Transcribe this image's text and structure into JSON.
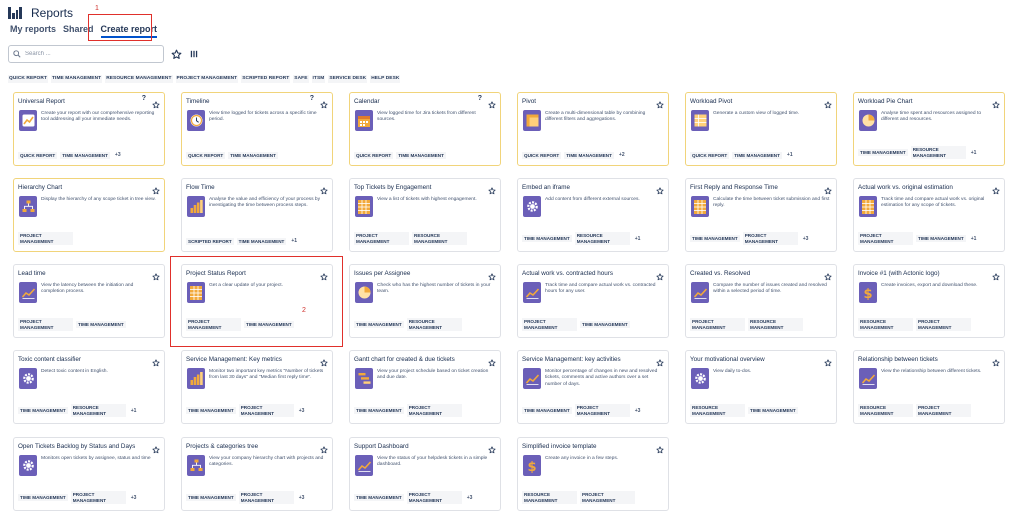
{
  "header": {
    "title": "Reports"
  },
  "annotations": {
    "one": "1",
    "two": "2"
  },
  "tabs": [
    {
      "label": "My reports"
    },
    {
      "label": "Shared"
    },
    {
      "label": "Create report"
    }
  ],
  "search": {
    "placeholder": "Search ..."
  },
  "filters": [
    "QUICK REPORT",
    "TIME MANAGEMENT",
    "RESOURCE MANAGEMENT",
    "PROJECT MANAGEMENT",
    "SCRIPTED REPORT",
    "SAFE",
    "ITSM",
    "SERVICE DESK",
    "HELP DESK"
  ],
  "cards": [
    {
      "title": "Universal Report",
      "help": "?",
      "desc": "Create your report with our comprehensive reporting tool addressing all your immediate needs.",
      "tags": [
        "QUICK REPORT",
        "TIME MANAGEMENT"
      ],
      "more": "+3",
      "icon": "universal-report-icon",
      "highlight": true
    },
    {
      "title": "Timeline",
      "help": "?",
      "desc": "View time logged for tickets across a specific time period.",
      "tags": [
        "QUICK REPORT",
        "TIME MANAGEMENT"
      ],
      "more": "",
      "icon": "clock-icon",
      "highlight": true
    },
    {
      "title": "Calendar",
      "help": "?",
      "desc": "View logged time for Jira tickets from different sources.",
      "tags": [
        "QUICK REPORT",
        "TIME MANAGEMENT"
      ],
      "more": "",
      "icon": "calendar-icon",
      "highlight": true
    },
    {
      "title": "Pivot",
      "help": "",
      "desc": "Create a multi-dimensional table by combining different filters and aggregations.",
      "tags": [
        "QUICK REPORT",
        "TIME MANAGEMENT"
      ],
      "more": "+2",
      "icon": "pivot-icon",
      "highlight": true
    },
    {
      "title": "Workload Pivot",
      "help": "",
      "desc": "Generate a custom view of logged time.",
      "tags": [
        "QUICK REPORT",
        "TIME MANAGEMENT"
      ],
      "more": "+1",
      "icon": "workload-pivot-icon",
      "highlight": true
    },
    {
      "title": "Workload Pie Chart",
      "help": "",
      "desc": "Analyse time spent and resources assigned to different and resources.",
      "tags": [
        "TIME MANAGEMENT",
        "RESOURCE MANAGEMENT"
      ],
      "more": "+1",
      "icon": "pie-chart-icon",
      "highlight": true
    },
    {
      "title": "Hierarchy Chart",
      "help": "",
      "desc": "Display the hierarchy of any scope ticket in tree view.",
      "tags": [
        "PROJECT MANAGEMENT"
      ],
      "more": "",
      "icon": "hierarchy-icon",
      "highlight": true
    },
    {
      "title": "Flow Time",
      "help": "",
      "desc": "Analyse the value and efficiency of your process by investigating the time between process steps.",
      "tags": [
        "SCRIPTED REPORT",
        "TIME MANAGEMENT"
      ],
      "more": "+1",
      "icon": "bar-chart-icon",
      "highlight": false
    },
    {
      "title": "Top Tickets by Engagement",
      "help": "",
      "desc": "View a list of tickets with highest engagement.",
      "tags": [
        "PROJECT MANAGEMENT",
        "RESOURCE MANAGEMENT"
      ],
      "more": "",
      "icon": "table-icon",
      "highlight": false
    },
    {
      "title": "Embed an iframe",
      "help": "",
      "desc": "Add content from different external sources.",
      "tags": [
        "TIME MANAGEMENT",
        "RESOURCE MANAGEMENT"
      ],
      "more": "+1",
      "icon": "gear-icon",
      "highlight": false
    },
    {
      "title": "First Reply and Response Time",
      "help": "",
      "desc": "Calculate the time between ticket submission and first reply.",
      "tags": [
        "TIME MANAGEMENT",
        "PROJECT MANAGEMENT"
      ],
      "more": "+3",
      "icon": "table-icon",
      "highlight": false
    },
    {
      "title": "Actual work vs. original estimation",
      "help": "",
      "desc": "Track time and compare actual work vs. original estimation for any scope of tickets.",
      "tags": [
        "PROJECT MANAGEMENT",
        "TIME MANAGEMENT"
      ],
      "more": "+1",
      "icon": "table-icon",
      "highlight": false
    },
    {
      "title": "Lead time",
      "help": "",
      "desc": "View the latency between the initiation and completion process.",
      "tags": [
        "PROJECT MANAGEMENT",
        "TIME MANAGEMENT"
      ],
      "more": "",
      "icon": "line-chart-icon",
      "highlight": false
    },
    {
      "title": "Project Status Report",
      "help": "",
      "desc": "Get a clear update of your project.",
      "tags": [
        "PROJECT MANAGEMENT",
        "TIME MANAGEMENT"
      ],
      "more": "",
      "icon": "table-icon",
      "highlight": false
    },
    {
      "title": "Issues per Assignee",
      "help": "",
      "desc": "Check who has the highest number of tickets in your team.",
      "tags": [
        "TIME MANAGEMENT",
        "RESOURCE MANAGEMENT"
      ],
      "more": "",
      "icon": "pie-chart-icon",
      "highlight": false
    },
    {
      "title": "Actual work vs. contracted hours",
      "help": "",
      "desc": "Track time and compare actual work vs. contracted hours for any user.",
      "tags": [
        "PROJECT MANAGEMENT",
        "TIME MANAGEMENT"
      ],
      "more": "",
      "icon": "line-chart-icon",
      "highlight": false
    },
    {
      "title": "Created vs. Resolved",
      "help": "",
      "desc": "Compare the number of issues created and resolved within a selected period of time.",
      "tags": [
        "PROJECT MANAGEMENT",
        "RESOURCE MANAGEMENT"
      ],
      "more": "",
      "icon": "line-chart-icon",
      "highlight": false
    },
    {
      "title": "Invoice #1 (with Actonic logo)",
      "help": "",
      "desc": "Create invoices, export and download these.",
      "tags": [
        "RESOURCE MANAGEMENT",
        "PROJECT MANAGEMENT"
      ],
      "more": "",
      "icon": "dollar-icon",
      "highlight": false
    },
    {
      "title": "Toxic content classifier",
      "help": "",
      "desc": "Detect toxic content in English.",
      "tags": [
        "TIME MANAGEMENT",
        "RESOURCE MANAGEMENT"
      ],
      "more": "+1",
      "icon": "gear-icon",
      "highlight": false
    },
    {
      "title": "Service Management: Key metrics",
      "help": "",
      "desc": "Monitor two important key metrics \"Number of tickets from last 30 days\" and \"Median first reply time\".",
      "tags": [
        "TIME MANAGEMENT",
        "PROJECT MANAGEMENT"
      ],
      "more": "+3",
      "icon": "bar-chart-icon",
      "highlight": false
    },
    {
      "title": "Gantt chart for created & due tickets",
      "help": "",
      "desc": "View your project schedule based on ticket creation and due date.",
      "tags": [
        "TIME MANAGEMENT",
        "PROJECT MANAGEMENT"
      ],
      "more": "",
      "icon": "gantt-icon",
      "highlight": false
    },
    {
      "title": "Service Management: key activities",
      "help": "",
      "desc": "Monitor percentage of changes in new and resolved tickets, comments and active authors over a set number of days.",
      "tags": [
        "TIME MANAGEMENT",
        "PROJECT MANAGEMENT"
      ],
      "more": "+3",
      "icon": "line-chart-icon",
      "highlight": false
    },
    {
      "title": "Your motivational overview",
      "help": "",
      "desc": "View daily to-dos.",
      "tags": [
        "RESOURCE MANAGEMENT",
        "TIME MANAGEMENT"
      ],
      "more": "",
      "icon": "gear-icon",
      "highlight": false
    },
    {
      "title": "Relationship between tickets",
      "help": "",
      "desc": "View the relationship between different tickets.",
      "tags": [
        "RESOURCE MANAGEMENT",
        "PROJECT MANAGEMENT"
      ],
      "more": "",
      "icon": "line-chart-icon",
      "highlight": false
    },
    {
      "title": "Open Tickets Backlog by Status and Days",
      "help": "",
      "desc": "Monitors open tickets by assignee, status and time",
      "tags": [
        "TIME MANAGEMENT",
        "PROJECT MANAGEMENT"
      ],
      "more": "+3",
      "icon": "gear-icon",
      "highlight": false
    },
    {
      "title": "Projects & categories tree",
      "help": "",
      "desc": "View your company hierarchy chart with projects and categories.",
      "tags": [
        "TIME MANAGEMENT",
        "PROJECT MANAGEMENT"
      ],
      "more": "+3",
      "icon": "hierarchy-icon",
      "highlight": false
    },
    {
      "title": "Support Dashboard",
      "help": "",
      "desc": "View the status of your helpdesk tickets in a simple dashboard.",
      "tags": [
        "TIME MANAGEMENT",
        "PROJECT MANAGEMENT"
      ],
      "more": "+3",
      "icon": "line-chart-icon",
      "highlight": false
    },
    {
      "title": "Simplified invoice template",
      "help": "",
      "desc": "Create any invoice in a few steps.",
      "tags": [
        "RESOURCE MANAGEMENT",
        "PROJECT MANAGEMENT"
      ],
      "more": "",
      "icon": "dollar-icon",
      "highlight": false
    }
  ]
}
